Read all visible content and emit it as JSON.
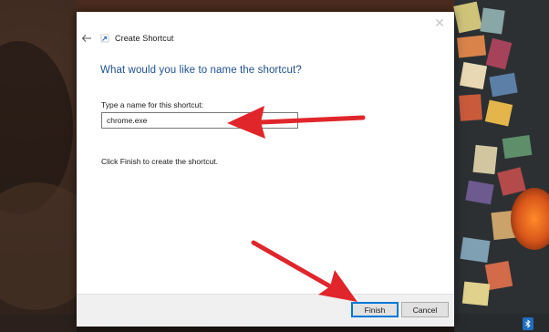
{
  "dialog": {
    "title": "Create Shortcut",
    "heading": "What would you like to name the shortcut?",
    "field_label": "Type a name for this shortcut:",
    "name_value": "chrome.exe",
    "hint": "Click Finish to create the shortcut.",
    "close_symbol": "✕"
  },
  "buttons": {
    "finish_label": "Finish",
    "cancel_label": "Cancel"
  },
  "icons": {
    "back": "back-arrow-icon",
    "app": "shortcut-wizard-icon",
    "close": "close-icon",
    "tray": "bluetooth-icon"
  },
  "colors": {
    "heading": "#1e4f8f",
    "annotation_arrow": "#e0262b",
    "default_button_border": "#0078d7",
    "footer": "#f0f0f0"
  }
}
